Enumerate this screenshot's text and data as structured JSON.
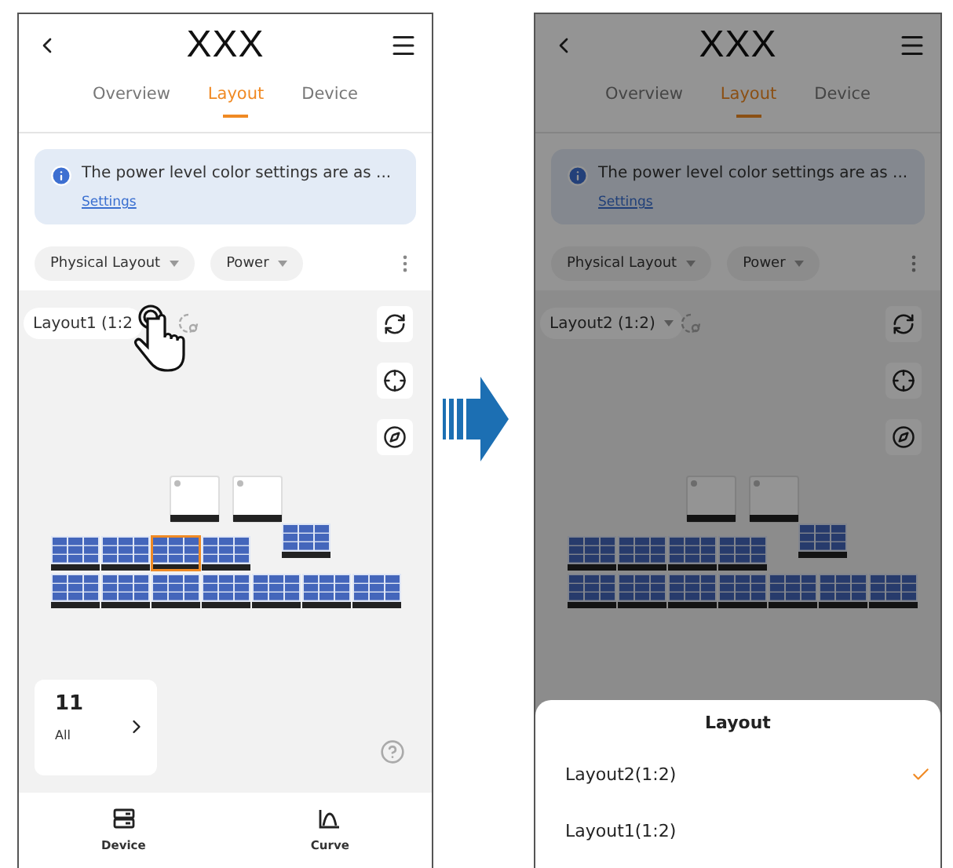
{
  "screens": [
    {
      "dimmed": false,
      "title": "XXX",
      "tabs": [
        {
          "label": "Overview",
          "selected": false
        },
        {
          "label": "Layout",
          "selected": true
        },
        {
          "label": "Device",
          "selected": false
        }
      ],
      "notice": {
        "text": "The power level color settings are as ...",
        "link": "Settings"
      },
      "filters": [
        "Physical Layout",
        "Power"
      ],
      "layout_select": {
        "label": "Layout1 (1:2",
        "pointer": true
      },
      "devices": [
        {
          "kind": "inverter",
          "selected": false
        },
        {
          "kind": "inverter",
          "selected": false
        },
        {
          "kind": "panel",
          "selected": false
        },
        {
          "kind": "panel",
          "selected": false
        },
        {
          "kind": "panel",
          "selected": true
        },
        {
          "kind": "panel",
          "selected": false
        },
        {
          "kind": "panel",
          "selected": false
        },
        {
          "kind": "panel",
          "selected": false
        },
        {
          "kind": "panel",
          "selected": false
        },
        {
          "kind": "panel",
          "selected": false
        },
        {
          "kind": "panel",
          "selected": false
        },
        {
          "kind": "panel",
          "selected": false
        },
        {
          "kind": "panel",
          "selected": false
        },
        {
          "kind": "panel",
          "selected": false
        }
      ],
      "summary": {
        "count": "11",
        "label": "All"
      },
      "nav": [
        "Device",
        "Curve"
      ]
    },
    {
      "dimmed": true,
      "title": "XXX",
      "tabs": [
        {
          "label": "Overview",
          "selected": false
        },
        {
          "label": "Layout",
          "selected": true
        },
        {
          "label": "Device",
          "selected": false
        }
      ],
      "notice": {
        "text": "The power level color settings are as ...",
        "link": "Settings"
      },
      "filters": [
        "Physical Layout",
        "Power"
      ],
      "layout_select": {
        "label": "Layout2 (1:2)",
        "pointer": false
      },
      "devices": [
        {
          "kind": "inverter",
          "selected": false
        },
        {
          "kind": "inverter",
          "selected": false
        },
        {
          "kind": "panel",
          "selected": false
        },
        {
          "kind": "panel",
          "selected": false
        },
        {
          "kind": "panel",
          "selected": false
        },
        {
          "kind": "panel",
          "selected": false
        },
        {
          "kind": "panel",
          "selected": false
        },
        {
          "kind": "panel",
          "selected": false
        },
        {
          "kind": "panel",
          "selected": false
        },
        {
          "kind": "panel",
          "selected": false
        },
        {
          "kind": "panel",
          "selected": false
        },
        {
          "kind": "panel",
          "selected": false
        },
        {
          "kind": "panel",
          "selected": false
        },
        {
          "kind": "panel",
          "selected": false
        }
      ],
      "sheet": {
        "title": "Layout",
        "options": [
          {
            "label": "Layout2(1:2)",
            "selected": true
          },
          {
            "label": "Layout1(1:2)",
            "selected": false
          }
        ]
      }
    }
  ]
}
